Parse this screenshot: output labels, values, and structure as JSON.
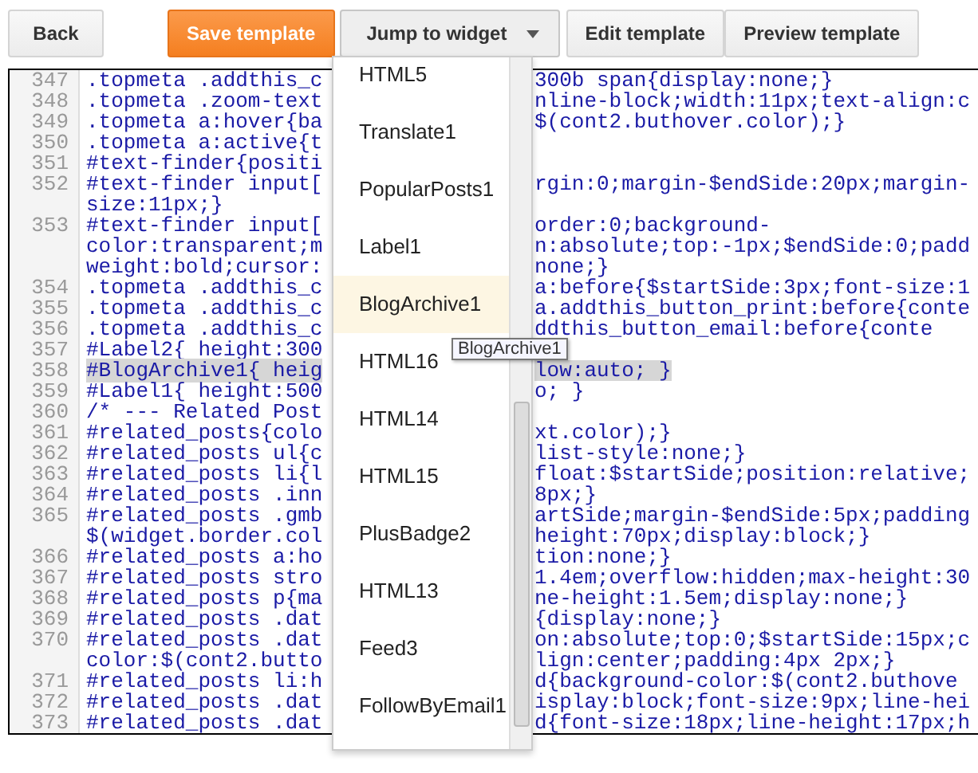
{
  "toolbar": [
    {
      "label": "Back",
      "kind": "default"
    },
    {
      "label": "Save template",
      "kind": "primary"
    },
    {
      "label": "Jump to widget",
      "kind": "dropdown"
    },
    {
      "label": "Edit template",
      "kind": "default"
    },
    {
      "label": "Preview template",
      "kind": "default"
    }
  ],
  "editor": {
    "lines": [
      {
        "number": "347",
        "selected": false,
        "rows": [
          {
            "left": ".topmeta .addthis_c",
            "right": "300b span{display:none;}"
          }
        ]
      },
      {
        "number": "348",
        "selected": false,
        "rows": [
          {
            "left": ".topmeta .zoom-text",
            "right": "nline-block;width:11px;text-align:c"
          }
        ]
      },
      {
        "number": "349",
        "selected": false,
        "rows": [
          {
            "left": ".topmeta a:hover{ba",
            "right": "$(cont2.buthover.color);}"
          }
        ]
      },
      {
        "number": "350",
        "selected": false,
        "rows": [
          {
            "left": ".topmeta a:active{t"
          }
        ]
      },
      {
        "number": "351",
        "selected": false,
        "rows": [
          {
            "left": "#text-finder{positi"
          }
        ]
      },
      {
        "number": "352",
        "selected": false,
        "rows": [
          {
            "left": "#text-finder input[",
            "right": "rgin:0;margin-$endSide:20px;margin-"
          },
          {
            "left": "size:11px;}"
          }
        ]
      },
      {
        "number": "353",
        "selected": false,
        "rows": [
          {
            "left": "#text-finder input[",
            "right": "order:0;background-"
          },
          {
            "left": "color:transparent;m",
            "right": "n:absolute;top:-1px;$endSide:0;padd"
          },
          {
            "left": "weight:bold;cursor:",
            "right": "none;}"
          }
        ]
      },
      {
        "number": "354",
        "selected": false,
        "rows": [
          {
            "left": ".topmeta .addthis_c",
            "right": "a:before{$startSide:3px;font-size:1"
          }
        ]
      },
      {
        "number": "355",
        "selected": false,
        "rows": [
          {
            "left": ".topmeta .addthis_c",
            "right": "a.addthis_button_print:before{conte"
          }
        ]
      },
      {
        "number": "356",
        "selected": false,
        "rows": [
          {
            "left": ".topmeta .addthis_c",
            "right": "ddthis_button_email:before{conte"
          }
        ]
      },
      {
        "number": "357",
        "selected": false,
        "rows": [
          {
            "left": "#Label2{ height:300"
          }
        ]
      },
      {
        "number": "358",
        "selected": true,
        "rows": [
          {
            "left": "#BlogArchive1{ heig",
            "right": "low:auto; }"
          }
        ]
      },
      {
        "number": "359",
        "selected": false,
        "rows": [
          {
            "left": "#Label1{ height:500",
            "right": "o; }"
          }
        ]
      },
      {
        "number": "360",
        "selected": false,
        "rows": [
          {
            "left": "/* --- Related Post"
          }
        ]
      },
      {
        "number": "361",
        "selected": false,
        "rows": [
          {
            "left": "#related_posts{colo",
            "right": "xt.color);}"
          }
        ]
      },
      {
        "number": "362",
        "selected": false,
        "rows": [
          {
            "left": "#related_posts ul{c",
            "right": "list-style:none;}"
          }
        ]
      },
      {
        "number": "363",
        "selected": false,
        "rows": [
          {
            "left": "#related_posts li{l",
            "right": "float:$startSide;position:relative;"
          }
        ]
      },
      {
        "number": "364",
        "selected": false,
        "rows": [
          {
            "left": "#related_posts .inn",
            "right": "8px;}"
          }
        ]
      },
      {
        "number": "365",
        "selected": false,
        "rows": [
          {
            "left": "#related_posts .gmb",
            "right": "artSide;margin-$endSide:5px;padding"
          },
          {
            "left": "$(widget.border.col",
            "right": "height:70px;display:block;}"
          }
        ]
      },
      {
        "number": "366",
        "selected": false,
        "rows": [
          {
            "left": "#related_posts a:ho",
            "right": "tion:none;}"
          }
        ]
      },
      {
        "number": "367",
        "selected": false,
        "rows": [
          {
            "left": "#related_posts stro",
            "right": "1.4em;overflow:hidden;max-height:30"
          }
        ]
      },
      {
        "number": "368",
        "selected": false,
        "rows": [
          {
            "left": "#related_posts p{ma",
            "right": "ne-height:1.5em;display:none;}"
          }
        ]
      },
      {
        "number": "369",
        "selected": false,
        "rows": [
          {
            "left": "#related_posts .dat",
            "right": "{display:none;}"
          }
        ]
      },
      {
        "number": "370",
        "selected": false,
        "rows": [
          {
            "left": "#related_posts .dat",
            "right": "on:absolute;top:0;$startSide:15px;c"
          },
          {
            "left": "color:$(cont2.butto",
            "right": "lign:center;padding:4px 2px;}"
          }
        ]
      },
      {
        "number": "371",
        "selected": false,
        "rows": [
          {
            "left": "#related_posts li:h",
            "right": "d{background-color:$(cont2.buthove"
          }
        ]
      },
      {
        "number": "372",
        "selected": false,
        "rows": [
          {
            "left": "#related_posts .dat",
            "right": "isplay:block;font-size:9px;line-hei"
          }
        ]
      },
      {
        "number": "373",
        "selected": false,
        "rows": [
          {
            "left": "#related_posts .dat",
            "right": "d{font-size:18px;line-height:17px;h"
          }
        ]
      }
    ]
  },
  "widget_menu": {
    "items": [
      {
        "label": "HTML5",
        "selected": false
      },
      {
        "label": "Translate1",
        "selected": false
      },
      {
        "label": "PopularPosts1",
        "selected": false
      },
      {
        "label": "Label1",
        "selected": false
      },
      {
        "label": "BlogArchive1",
        "selected": true
      },
      {
        "label": "HTML16",
        "selected": false
      },
      {
        "label": "HTML14",
        "selected": false
      },
      {
        "label": "HTML15",
        "selected": false
      },
      {
        "label": "PlusBadge2",
        "selected": false
      },
      {
        "label": "HTML13",
        "selected": false
      },
      {
        "label": "Feed3",
        "selected": false
      },
      {
        "label": "FollowByEmail1",
        "selected": false
      }
    ],
    "tooltip": "BlogArchive1"
  }
}
